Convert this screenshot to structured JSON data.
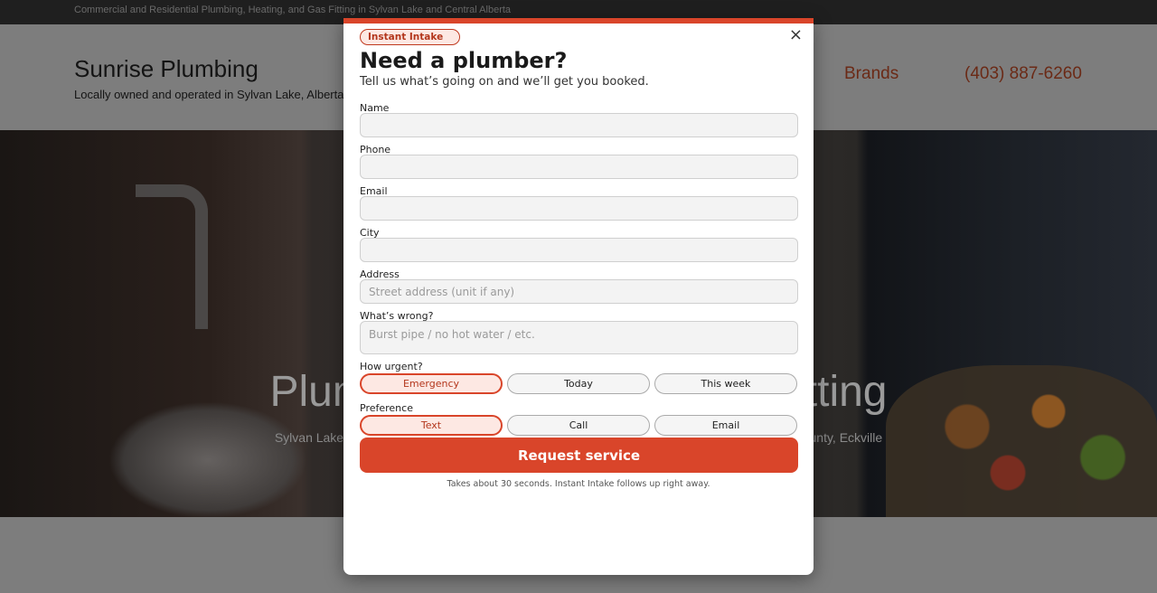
{
  "site": {
    "topbar_text": "Commercial and Residential Plumbing, Heating, and Gas Fitting in Sylvan Lake and Central Alberta",
    "title": "Sunrise Plumbing",
    "tagline": "Locally owned and operated in Sylvan Lake, Alberta",
    "nav": {
      "brands": "Brands",
      "phone": "(403) 887-6260"
    },
    "hero": {
      "title": "Plumbing, Heating & Gas Fitting",
      "subtitle": "Sylvan Lake, Red Deer, Blackfalds, Lacombe, Innisfail, Penhold, Bentley, Rimbey, Red Deer County, Eckville"
    }
  },
  "modal": {
    "badge": "Instant Intake",
    "title": "Need a plumber?",
    "subtitle": "Tell us what’s going on and we’ll get you booked.",
    "fields": {
      "name": {
        "label": "Name",
        "placeholder": ""
      },
      "phone": {
        "label": "Phone",
        "placeholder": ""
      },
      "email": {
        "label": "Email",
        "placeholder": ""
      },
      "city": {
        "label": "City",
        "placeholder": ""
      },
      "address": {
        "label": "Address",
        "placeholder": "Street address (unit if any)"
      },
      "issue": {
        "label": "What’s wrong?",
        "placeholder": "Burst pipe / no hot water / etc."
      }
    },
    "urgency": {
      "label": "How urgent?",
      "options": [
        "Emergency",
        "Today",
        "This week"
      ],
      "selected": "Emergency"
    },
    "preference": {
      "label": "Preference",
      "options": [
        "Text",
        "Call",
        "Email"
      ],
      "selected": "Text"
    },
    "submit_label": "Request service",
    "footnote": "Takes about 30 seconds. Instant Intake follows up right away.",
    "close_symbol": "×",
    "accent_color": "#d9452a"
  }
}
